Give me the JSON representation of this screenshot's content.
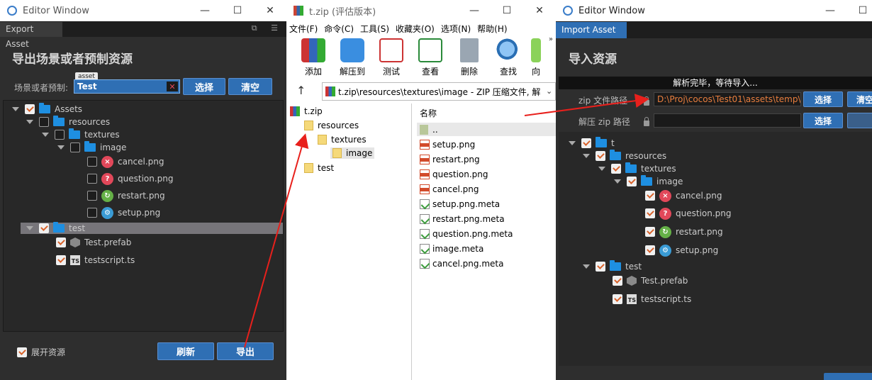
{
  "left": {
    "title": "Editor Window",
    "tab": "Export Asset",
    "heading": "导出场景或者预制资源",
    "field_label": "场景或者预制:",
    "asset_tag": "asset",
    "field_value": "Test",
    "btn_select": "选择",
    "btn_clear": "清空",
    "tree": [
      {
        "label": "Assets",
        "type": "folder",
        "checked": true
      },
      {
        "label": "resources",
        "type": "folder",
        "checked": false
      },
      {
        "label": "textures",
        "type": "folder",
        "checked": false
      },
      {
        "label": "image",
        "type": "folder",
        "checked": false
      },
      {
        "label": "cancel.png",
        "type": "cancel",
        "checked": false
      },
      {
        "label": "question.png",
        "type": "question",
        "checked": false
      },
      {
        "label": "restart.png",
        "type": "restart",
        "checked": false
      },
      {
        "label": "setup.png",
        "type": "setup",
        "checked": false
      },
      {
        "label": "test",
        "type": "folder",
        "checked": true
      },
      {
        "label": "Test.prefab",
        "type": "prefab",
        "checked": true
      },
      {
        "label": "testscript.ts",
        "type": "ts",
        "checked": true
      }
    ],
    "expand_label": "展开资源",
    "btn_refresh": "刷新",
    "btn_export": "导出"
  },
  "rar": {
    "title": "t.zip (评估版本)",
    "menu": [
      "文件(F)",
      "命令(C)",
      "工具(S)",
      "收藏夹(O)",
      "选项(N)",
      "帮助(H)"
    ],
    "tools": [
      "添加",
      "解压到",
      "测试",
      "查看",
      "删除",
      "查找",
      "向"
    ],
    "path": "t.zip\\resources\\textures\\image - ZIP 压缩文件, 解",
    "tree": [
      "t.zip",
      "resources",
      "textures",
      "image",
      "test"
    ],
    "col_name": "名称",
    "files": [
      "..",
      "setup.png",
      "restart.png",
      "question.png",
      "cancel.png",
      "setup.png.meta",
      "restart.png.meta",
      "question.png.meta",
      "image.meta",
      "cancel.png.meta"
    ]
  },
  "right": {
    "title": "Editor Window",
    "tab": "Import Asset",
    "heading": "导入资源",
    "status": "解析完毕，等待导入...",
    "zip_label": "zip 文件路径",
    "zip_value": "D:\\Proj\\cocos\\Test01\\assets\\temp\\t",
    "unzip_label": "解压 zip 路径",
    "unzip_value": "",
    "btn_select": "选择",
    "btn_select2": "选择",
    "btn_clear": "清空",
    "tree": [
      {
        "label": "t",
        "type": "folder",
        "checked": true
      },
      {
        "label": "resources",
        "type": "folder",
        "checked": true
      },
      {
        "label": "textures",
        "type": "folder",
        "checked": true
      },
      {
        "label": "image",
        "type": "folder",
        "checked": true
      },
      {
        "label": "cancel.png",
        "type": "cancel",
        "checked": true
      },
      {
        "label": "question.png",
        "type": "question",
        "checked": true
      },
      {
        "label": "restart.png",
        "type": "restart",
        "checked": true
      },
      {
        "label": "setup.png",
        "type": "setup",
        "checked": true
      },
      {
        "label": "test",
        "type": "folder",
        "checked": true
      },
      {
        "label": "Test.prefab",
        "type": "prefab",
        "checked": true
      },
      {
        "label": "testscript.ts",
        "type": "ts",
        "checked": true
      }
    ]
  },
  "colors": {
    "accent": "#2f6fb4",
    "annotation": "#e8201c",
    "path_text": "#e87e3e"
  }
}
